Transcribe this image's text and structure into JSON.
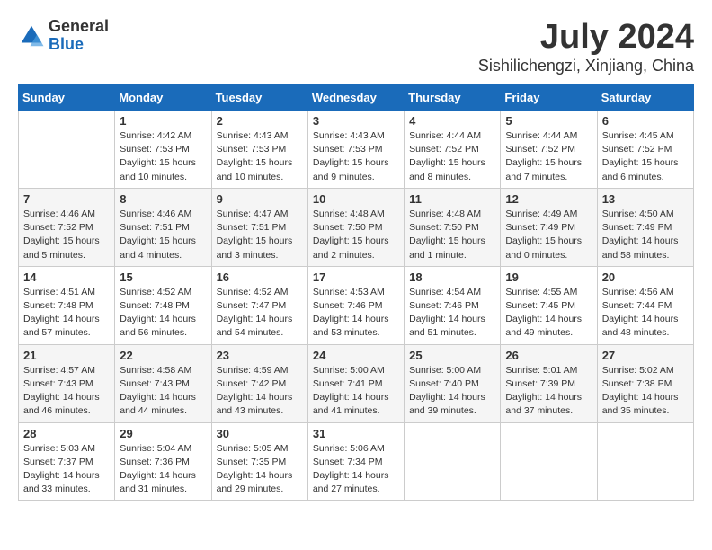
{
  "logo": {
    "general": "General",
    "blue": "Blue"
  },
  "title": "July 2024",
  "location": "Sishilichengzi, Xinjiang, China",
  "days_header": [
    "Sunday",
    "Monday",
    "Tuesday",
    "Wednesday",
    "Thursday",
    "Friday",
    "Saturday"
  ],
  "weeks": [
    [
      {
        "day": "",
        "sunrise": "",
        "sunset": "",
        "daylight": ""
      },
      {
        "day": "1",
        "sunrise": "Sunrise: 4:42 AM",
        "sunset": "Sunset: 7:53 PM",
        "daylight": "Daylight: 15 hours and 10 minutes."
      },
      {
        "day": "2",
        "sunrise": "Sunrise: 4:43 AM",
        "sunset": "Sunset: 7:53 PM",
        "daylight": "Daylight: 15 hours and 10 minutes."
      },
      {
        "day": "3",
        "sunrise": "Sunrise: 4:43 AM",
        "sunset": "Sunset: 7:53 PM",
        "daylight": "Daylight: 15 hours and 9 minutes."
      },
      {
        "day": "4",
        "sunrise": "Sunrise: 4:44 AM",
        "sunset": "Sunset: 7:52 PM",
        "daylight": "Daylight: 15 hours and 8 minutes."
      },
      {
        "day": "5",
        "sunrise": "Sunrise: 4:44 AM",
        "sunset": "Sunset: 7:52 PM",
        "daylight": "Daylight: 15 hours and 7 minutes."
      },
      {
        "day": "6",
        "sunrise": "Sunrise: 4:45 AM",
        "sunset": "Sunset: 7:52 PM",
        "daylight": "Daylight: 15 hours and 6 minutes."
      }
    ],
    [
      {
        "day": "7",
        "sunrise": "Sunrise: 4:46 AM",
        "sunset": "Sunset: 7:52 PM",
        "daylight": "Daylight: 15 hours and 5 minutes."
      },
      {
        "day": "8",
        "sunrise": "Sunrise: 4:46 AM",
        "sunset": "Sunset: 7:51 PM",
        "daylight": "Daylight: 15 hours and 4 minutes."
      },
      {
        "day": "9",
        "sunrise": "Sunrise: 4:47 AM",
        "sunset": "Sunset: 7:51 PM",
        "daylight": "Daylight: 15 hours and 3 minutes."
      },
      {
        "day": "10",
        "sunrise": "Sunrise: 4:48 AM",
        "sunset": "Sunset: 7:50 PM",
        "daylight": "Daylight: 15 hours and 2 minutes."
      },
      {
        "day": "11",
        "sunrise": "Sunrise: 4:48 AM",
        "sunset": "Sunset: 7:50 PM",
        "daylight": "Daylight: 15 hours and 1 minute."
      },
      {
        "day": "12",
        "sunrise": "Sunrise: 4:49 AM",
        "sunset": "Sunset: 7:49 PM",
        "daylight": "Daylight: 15 hours and 0 minutes."
      },
      {
        "day": "13",
        "sunrise": "Sunrise: 4:50 AM",
        "sunset": "Sunset: 7:49 PM",
        "daylight": "Daylight: 14 hours and 58 minutes."
      }
    ],
    [
      {
        "day": "14",
        "sunrise": "Sunrise: 4:51 AM",
        "sunset": "Sunset: 7:48 PM",
        "daylight": "Daylight: 14 hours and 57 minutes."
      },
      {
        "day": "15",
        "sunrise": "Sunrise: 4:52 AM",
        "sunset": "Sunset: 7:48 PM",
        "daylight": "Daylight: 14 hours and 56 minutes."
      },
      {
        "day": "16",
        "sunrise": "Sunrise: 4:52 AM",
        "sunset": "Sunset: 7:47 PM",
        "daylight": "Daylight: 14 hours and 54 minutes."
      },
      {
        "day": "17",
        "sunrise": "Sunrise: 4:53 AM",
        "sunset": "Sunset: 7:46 PM",
        "daylight": "Daylight: 14 hours and 53 minutes."
      },
      {
        "day": "18",
        "sunrise": "Sunrise: 4:54 AM",
        "sunset": "Sunset: 7:46 PM",
        "daylight": "Daylight: 14 hours and 51 minutes."
      },
      {
        "day": "19",
        "sunrise": "Sunrise: 4:55 AM",
        "sunset": "Sunset: 7:45 PM",
        "daylight": "Daylight: 14 hours and 49 minutes."
      },
      {
        "day": "20",
        "sunrise": "Sunrise: 4:56 AM",
        "sunset": "Sunset: 7:44 PM",
        "daylight": "Daylight: 14 hours and 48 minutes."
      }
    ],
    [
      {
        "day": "21",
        "sunrise": "Sunrise: 4:57 AM",
        "sunset": "Sunset: 7:43 PM",
        "daylight": "Daylight: 14 hours and 46 minutes."
      },
      {
        "day": "22",
        "sunrise": "Sunrise: 4:58 AM",
        "sunset": "Sunset: 7:43 PM",
        "daylight": "Daylight: 14 hours and 44 minutes."
      },
      {
        "day": "23",
        "sunrise": "Sunrise: 4:59 AM",
        "sunset": "Sunset: 7:42 PM",
        "daylight": "Daylight: 14 hours and 43 minutes."
      },
      {
        "day": "24",
        "sunrise": "Sunrise: 5:00 AM",
        "sunset": "Sunset: 7:41 PM",
        "daylight": "Daylight: 14 hours and 41 minutes."
      },
      {
        "day": "25",
        "sunrise": "Sunrise: 5:00 AM",
        "sunset": "Sunset: 7:40 PM",
        "daylight": "Daylight: 14 hours and 39 minutes."
      },
      {
        "day": "26",
        "sunrise": "Sunrise: 5:01 AM",
        "sunset": "Sunset: 7:39 PM",
        "daylight": "Daylight: 14 hours and 37 minutes."
      },
      {
        "day": "27",
        "sunrise": "Sunrise: 5:02 AM",
        "sunset": "Sunset: 7:38 PM",
        "daylight": "Daylight: 14 hours and 35 minutes."
      }
    ],
    [
      {
        "day": "28",
        "sunrise": "Sunrise: 5:03 AM",
        "sunset": "Sunset: 7:37 PM",
        "daylight": "Daylight: 14 hours and 33 minutes."
      },
      {
        "day": "29",
        "sunrise": "Sunrise: 5:04 AM",
        "sunset": "Sunset: 7:36 PM",
        "daylight": "Daylight: 14 hours and 31 minutes."
      },
      {
        "day": "30",
        "sunrise": "Sunrise: 5:05 AM",
        "sunset": "Sunset: 7:35 PM",
        "daylight": "Daylight: 14 hours and 29 minutes."
      },
      {
        "day": "31",
        "sunrise": "Sunrise: 5:06 AM",
        "sunset": "Sunset: 7:34 PM",
        "daylight": "Daylight: 14 hours and 27 minutes."
      },
      {
        "day": "",
        "sunrise": "",
        "sunset": "",
        "daylight": ""
      },
      {
        "day": "",
        "sunrise": "",
        "sunset": "",
        "daylight": ""
      },
      {
        "day": "",
        "sunrise": "",
        "sunset": "",
        "daylight": ""
      }
    ]
  ]
}
